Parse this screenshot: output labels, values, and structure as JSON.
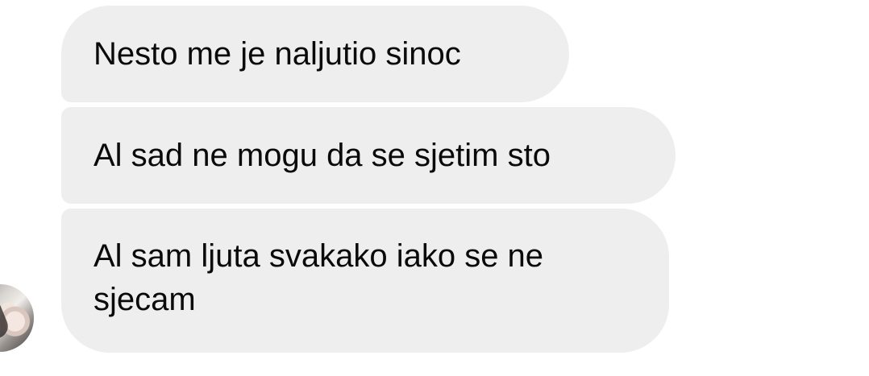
{
  "chat": {
    "messages": [
      {
        "text": "Nesto me je naljutio sinoc"
      },
      {
        "text": "Al sad ne mogu da se sjetim sto"
      },
      {
        "text": "Al sam ljuta svakako iako se ne sjecam"
      }
    ],
    "avatar_icon": "profile-avatar",
    "bubble_color": "#eeeeee",
    "text_color": "#0a0a0a"
  }
}
